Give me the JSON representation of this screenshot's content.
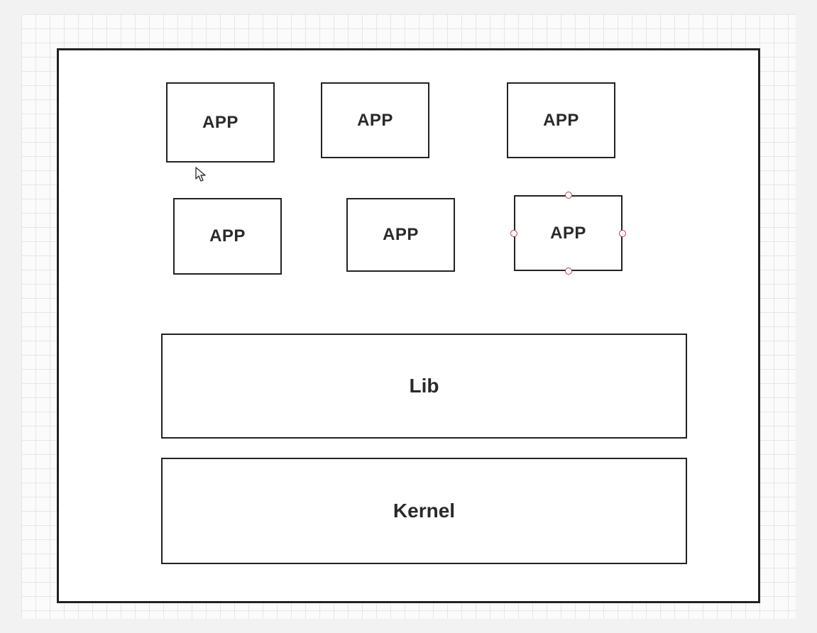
{
  "diagram": {
    "app1": {
      "label": "APP"
    },
    "app2": {
      "label": "APP"
    },
    "app3": {
      "label": "APP"
    },
    "app4": {
      "label": "APP"
    },
    "app5": {
      "label": "APP"
    },
    "app6": {
      "label": "APP",
      "selected": true
    },
    "lib": {
      "label": "Lib"
    },
    "kernel": {
      "label": "Kernel"
    }
  }
}
